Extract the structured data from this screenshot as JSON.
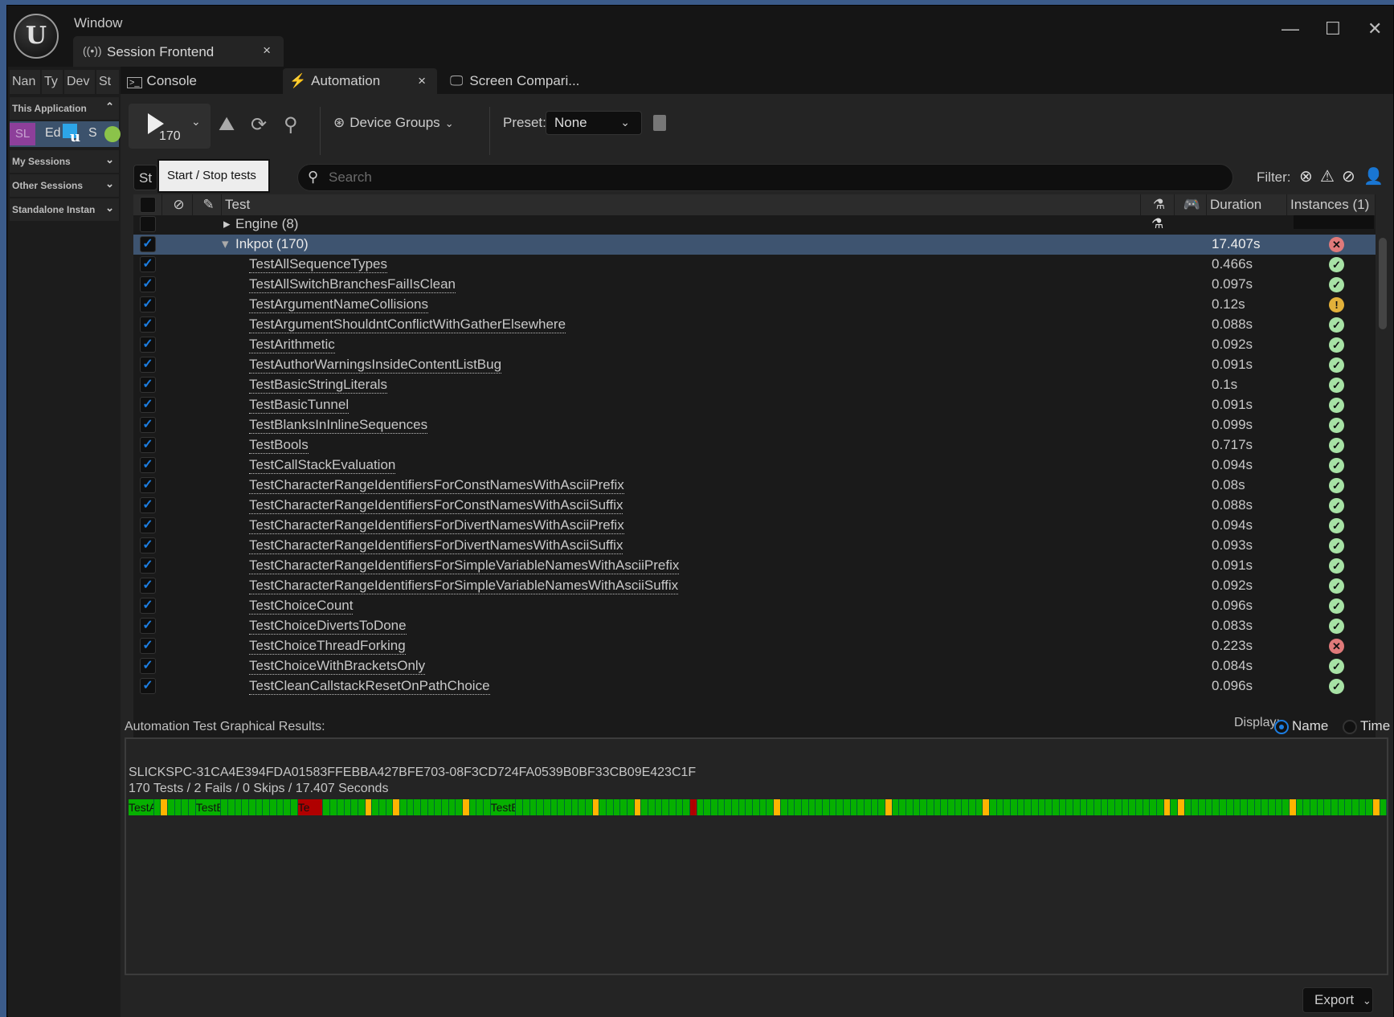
{
  "window": {
    "menu": "Window",
    "main_tab": "Session Frontend",
    "main_tab_close": "×",
    "controls": {
      "minimize": "—",
      "maximize": "☐",
      "close": "✕"
    }
  },
  "sessions_panel": {
    "columns": [
      "Nan",
      "Ty",
      "Dev",
      "St"
    ],
    "groups": [
      {
        "label": "This Application",
        "expanded": true
      },
      {
        "label": "My Sessions",
        "expanded": false
      },
      {
        "label": "Other Sessions",
        "expanded": false
      },
      {
        "label": "Standalone Instan",
        "expanded": false
      }
    ],
    "session": {
      "badge": "SL",
      "name": "Ed",
      "status_text": "S",
      "status_color": "#8bc34a"
    }
  },
  "sub_tabs": [
    {
      "label": "Console",
      "icon": "console-icon"
    },
    {
      "label": "Automation",
      "icon": "automation-icon",
      "active": true,
      "close": "×"
    },
    {
      "label": "Screen Compari...",
      "icon": "monitor-icon"
    }
  ],
  "toolbar": {
    "play_count": "170",
    "device_groups": "Device Groups",
    "preset_label": "Preset:",
    "preset_value": "None",
    "tooltip": "Start / Stop tests",
    "st_button": "St"
  },
  "search": {
    "placeholder": "Search",
    "value": ""
  },
  "filter": {
    "label": "Filter:"
  },
  "table": {
    "headers": {
      "test": "Test",
      "duration": "Duration",
      "instances": "Instances (1)"
    },
    "groups": [
      {
        "name": "Engine (8)",
        "checked": false,
        "expanded": false
      },
      {
        "name": "Inkpot (170)",
        "checked": true,
        "expanded": true,
        "duration": "17.407s",
        "status": "fail"
      }
    ],
    "rows": [
      {
        "name": "TestAllSequenceTypes",
        "duration": "0.466s",
        "status": "pass"
      },
      {
        "name": "TestAllSwitchBranchesFailIsClean",
        "duration": "0.097s",
        "status": "pass"
      },
      {
        "name": "TestArgumentNameCollisions",
        "duration": "0.12s",
        "status": "warn"
      },
      {
        "name": "TestArgumentShouldntConflictWithGatherElsewhere",
        "duration": "0.088s",
        "status": "pass"
      },
      {
        "name": "TestArithmetic",
        "duration": "0.092s",
        "status": "pass"
      },
      {
        "name": "TestAuthorWarningsInsideContentListBug",
        "duration": "0.091s",
        "status": "pass"
      },
      {
        "name": "TestBasicStringLiterals",
        "duration": "0.1s",
        "status": "pass"
      },
      {
        "name": "TestBasicTunnel",
        "duration": "0.091s",
        "status": "pass"
      },
      {
        "name": "TestBlanksInInlineSequences",
        "duration": "0.099s",
        "status": "pass"
      },
      {
        "name": "TestBools",
        "duration": "0.717s",
        "status": "pass"
      },
      {
        "name": "TestCallStackEvaluation",
        "duration": "0.094s",
        "status": "pass"
      },
      {
        "name": "TestCharacterRangeIdentifiersForConstNamesWithAsciiPrefix",
        "duration": "0.08s",
        "status": "pass"
      },
      {
        "name": "TestCharacterRangeIdentifiersForConstNamesWithAsciiSuffix",
        "duration": "0.088s",
        "status": "pass"
      },
      {
        "name": "TestCharacterRangeIdentifiersForDivertNamesWithAsciiPrefix",
        "duration": "0.094s",
        "status": "pass"
      },
      {
        "name": "TestCharacterRangeIdentifiersForDivertNamesWithAsciiSuffix",
        "duration": "0.093s",
        "status": "pass"
      },
      {
        "name": "TestCharacterRangeIdentifiersForSimpleVariableNamesWithAsciiPrefix",
        "duration": "0.091s",
        "status": "pass"
      },
      {
        "name": "TestCharacterRangeIdentifiersForSimpleVariableNamesWithAsciiSuffix",
        "duration": "0.092s",
        "status": "pass"
      },
      {
        "name": "TestChoiceCount",
        "duration": "0.096s",
        "status": "pass"
      },
      {
        "name": "TestChoiceDivertsToDone",
        "duration": "0.083s",
        "status": "pass"
      },
      {
        "name": "TestChoiceThreadForking",
        "duration": "0.223s",
        "status": "fail"
      },
      {
        "name": "TestChoiceWithBracketsOnly",
        "duration": "0.084s",
        "status": "pass"
      },
      {
        "name": "TestCleanCallstackResetOnPathChoice",
        "duration": "0.096s",
        "status": "pass"
      }
    ]
  },
  "results": {
    "label": "Automation Test Graphical Results:",
    "display_label": "Display:",
    "display_options": [
      "Name",
      "Time"
    ],
    "display_selected": "Name",
    "session_id": "SLICKSPC-31CA4E394FDA01583FFEBBA427BFE703-08F3CD724FA0539B0BF33CB09E423C1F",
    "summary": "170 Tests / 2 Fails / 0 Skips / 17.407 Seconds",
    "bar_labels": {
      "0": "TestA",
      "7": "TestBoo",
      "19": "Te",
      "44": "TestE"
    },
    "bar_warn_indices": [
      2,
      26,
      30,
      40,
      56,
      62,
      82,
      98,
      112,
      138,
      140,
      156,
      168
    ],
    "bar_fail_indices": [
      19,
      70
    ],
    "total": 170
  },
  "export_label": "Export"
}
